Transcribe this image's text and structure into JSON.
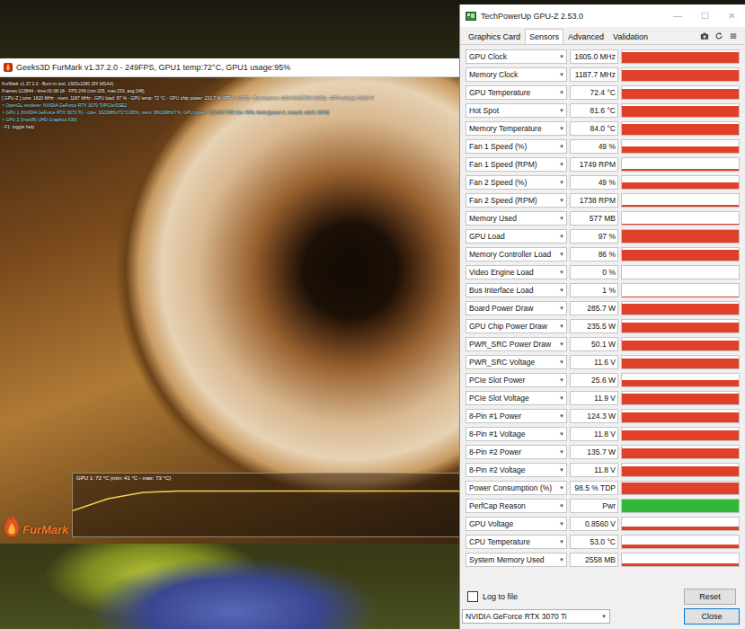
{
  "furmark": {
    "title": "Geeks3D FurMark v1.37.2.0 - 249FPS, GPU1 temp:72°C, GPU1 usage:95%",
    "osd": [
      {
        "text": "FurMark v1.37.2.0 - Burn-in test, 1920x1080 (8X MSAA)",
        "color": "#ffffff"
      },
      {
        "text": "Frames:123844 - time:00:08:18 - FPS:249 (min:205, max:253, avg:248)",
        "color": "#ffffff"
      },
      {
        "text": "[ GPU-Z ] core: 1620 MHz - mem: 1187 MHz - GPU load: 97 % - GPU temp: 72 °C - GPU chip power: 232.7 W (PPW: 1.070) - Board power: 282.4 W (PPW: 0.882) - GPU voltage: 0.862 V",
        "color": "#ffffff"
      },
      {
        "text": "> OpenGL renderer: NVIDIA GeForce RTX 3070 Ti/PCIe/SSE2",
        "color": "#9fe8ff"
      },
      {
        "text": "> GPU 1 (NVIDIA GeForce RTX 3070 Ti) - core: 1620MHz/72°C/95%, mem: 9501MHz/7%, GPU power: 102.6% TDP, fan: 49%, limits:[power:1, temp:0, volt:0, OV:0]",
        "color": "#9fe8ff"
      },
      {
        "text": "> GPU 2 (Intel(R) UHD Graphics 630)",
        "color": "#9fe8ff"
      },
      {
        "text": "- F1: toggle help",
        "color": "#ffffff"
      }
    ],
    "graph": {
      "label": "GPU 1: 72 °C (min: 41 °C - max: 73 °C)",
      "values": [
        41,
        60,
        70,
        72,
        72,
        72,
        72,
        72,
        72,
        72,
        72,
        72
      ]
    },
    "logo": "FurMark"
  },
  "gpuz": {
    "title": "TechPowerUp GPU-Z 2.53.0",
    "controls": [
      "—",
      "☐",
      "✕"
    ],
    "tabs": [
      {
        "label": "Graphics Card",
        "selected": false
      },
      {
        "label": "Sensors",
        "selected": true
      },
      {
        "label": "Advanced",
        "selected": false
      },
      {
        "label": "Validation",
        "selected": false
      }
    ],
    "dropdown_glyph": "▼",
    "sensors": [
      {
        "label": "GPU Clock",
        "value": "1605.0 MHz",
        "level": 0.85,
        "color": "#e0402a"
      },
      {
        "label": "Memory Clock",
        "value": "1187.7 MHz",
        "level": 0.85,
        "color": "#e0402a"
      },
      {
        "label": "GPU Temperature",
        "value": "72.4 °C",
        "level": 0.8,
        "color": "#e0402a"
      },
      {
        "label": "Hot Spot",
        "value": "81.6 °C",
        "level": 0.85,
        "color": "#e0402a"
      },
      {
        "label": "Memory Temperature",
        "value": "84.0 °C",
        "level": 0.85,
        "color": "#e0402a"
      },
      {
        "label": "Fan 1 Speed (%)",
        "value": "49 %",
        "level": 0.5,
        "color": "#e0402a"
      },
      {
        "label": "Fan 1 Speed (RPM)",
        "value": "1749 RPM",
        "level": 0.15,
        "color": "#e0402a"
      },
      {
        "label": "Fan 2 Speed (%)",
        "value": "49 %",
        "level": 0.5,
        "color": "#e0402a"
      },
      {
        "label": "Fan 2 Speed (RPM)",
        "value": "1738 RPM",
        "level": 0.15,
        "color": "#e0402a"
      },
      {
        "label": "Memory Used",
        "value": "577 MB",
        "level": 0.06,
        "color": "#e0402a"
      },
      {
        "label": "GPU Load",
        "value": "97 %",
        "level": 0.97,
        "color": "#e0402a"
      },
      {
        "label": "Memory Controller Load",
        "value": "86 %",
        "level": 0.86,
        "color": "#e0402a"
      },
      {
        "label": "Video Engine Load",
        "value": "0 %",
        "level": 0,
        "color": "#e0402a"
      },
      {
        "label": "Bus Interface Load",
        "value": "1 %",
        "level": 0.03,
        "color": "#e0402a"
      },
      {
        "label": "Board Power Draw",
        "value": "285.7 W",
        "level": 0.85,
        "color": "#e0402a"
      },
      {
        "label": "GPU Chip Power Draw",
        "value": "235.5 W",
        "level": 0.8,
        "color": "#e0402a"
      },
      {
        "label": "PWR_SRC Power Draw",
        "value": "50.1 W",
        "level": 0.8,
        "color": "#e0402a"
      },
      {
        "label": "PWR_SRC Voltage",
        "value": "11.6 V",
        "level": 0.8,
        "color": "#e0402a"
      },
      {
        "label": "PCIe Slot Power",
        "value": "25.6 W",
        "level": 0.5,
        "color": "#e0402a"
      },
      {
        "label": "PCIe Slot Voltage",
        "value": "11.9 V",
        "level": 0.85,
        "color": "#e0402a"
      },
      {
        "label": "8-Pin #1 Power",
        "value": "124.3 W",
        "level": 0.8,
        "color": "#e0402a"
      },
      {
        "label": "8-Pin #1 Voltage",
        "value": "11.8 V",
        "level": 0.8,
        "color": "#e0402a"
      },
      {
        "label": "8-Pin #2 Power",
        "value": "135.7 W",
        "level": 0.8,
        "color": "#e0402a"
      },
      {
        "label": "8-Pin #2 Voltage",
        "value": "11.8 V",
        "level": 0.8,
        "color": "#e0402a"
      },
      {
        "label": "Power Consumption (%)",
        "value": "98.5 % TDP",
        "level": 0.9,
        "color": "#e0402a"
      },
      {
        "label": "PerfCap Reason",
        "value": "Pwr",
        "level": 1,
        "color": "#2fb83a"
      },
      {
        "label": "GPU Voltage",
        "value": "0.8560 V",
        "level": 0.3,
        "color": "#e0402a"
      },
      {
        "label": "CPU Temperature",
        "value": "53.0 °C",
        "level": 0.3,
        "color": "#e0402a"
      },
      {
        "label": "System Memory Used",
        "value": "2558 MB",
        "level": 0.2,
        "color": "#e0402a"
      }
    ],
    "log_to_file": {
      "label": "Log to file",
      "checked": false
    },
    "reset": "Reset",
    "device": {
      "value": "NVIDIA GeForce RTX 3070 Ti",
      "glyph": "▼"
    },
    "close": "Close"
  }
}
